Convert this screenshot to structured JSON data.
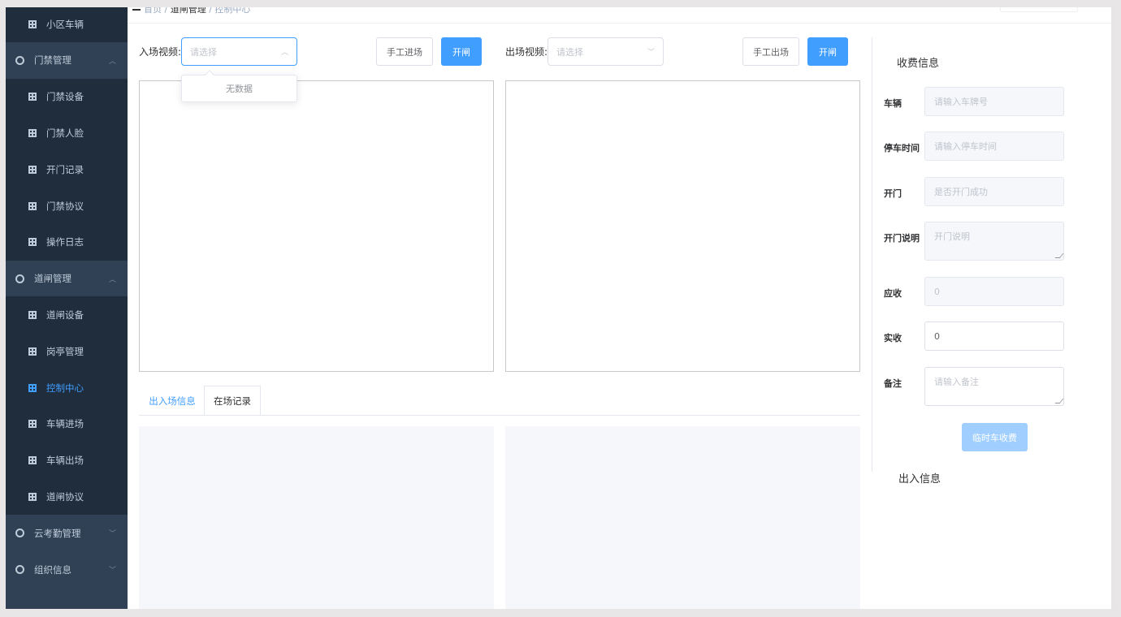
{
  "sidebar": {
    "items": [
      {
        "label": "小区车辆",
        "kind": "sub",
        "icon": "grid-icon"
      },
      {
        "label": "门禁管理",
        "kind": "group",
        "icon": "gear-icon",
        "chevron": "^"
      },
      {
        "label": "门禁设备",
        "kind": "sub",
        "icon": "grid-icon"
      },
      {
        "label": "门禁人脸",
        "kind": "sub",
        "icon": "grid-icon"
      },
      {
        "label": "开门记录",
        "kind": "sub",
        "icon": "grid-icon"
      },
      {
        "label": "门禁协议",
        "kind": "sub",
        "icon": "grid-icon"
      },
      {
        "label": "操作日志",
        "kind": "sub",
        "icon": "grid-icon"
      },
      {
        "label": "道闸管理",
        "kind": "group",
        "icon": "gear-icon",
        "chevron": "^"
      },
      {
        "label": "道闸设备",
        "kind": "sub",
        "icon": "grid-icon"
      },
      {
        "label": "岗亭管理",
        "kind": "sub",
        "icon": "grid-icon"
      },
      {
        "label": "控制中心",
        "kind": "sub",
        "icon": "grid-icon",
        "active": true
      },
      {
        "label": "车辆进场",
        "kind": "sub",
        "icon": "grid-icon"
      },
      {
        "label": "车辆出场",
        "kind": "sub",
        "icon": "grid-icon"
      },
      {
        "label": "道闸协议",
        "kind": "sub",
        "icon": "grid-icon"
      },
      {
        "label": "云考勤管理",
        "kind": "group",
        "icon": "gear-icon",
        "chevron": "v"
      },
      {
        "label": "组织信息",
        "kind": "group",
        "icon": "gear-icon",
        "chevron": "v"
      }
    ]
  },
  "breadcrumb": {
    "home": "首页",
    "level2": "道闸管理",
    "current": "控制中心"
  },
  "entry": {
    "label": "入场视频:",
    "select_placeholder": "请选择",
    "manual_button": "手工进场",
    "open_button": "开闸",
    "dropdown_empty": "无数据"
  },
  "exit": {
    "label": "出场视频:",
    "select_placeholder": "请选择",
    "manual_button": "手工出场",
    "open_button": "开闸"
  },
  "tabs": [
    {
      "label": "出入场信息",
      "active": true
    },
    {
      "label": "在场记录",
      "active": false
    }
  ],
  "fee": {
    "title": "收费信息",
    "fields": [
      {
        "label": "车辆",
        "placeholder": "请输入车牌号",
        "value": ""
      },
      {
        "label": "停车时间",
        "placeholder": "请输入停车时间",
        "value": ""
      },
      {
        "label": "开门",
        "placeholder": "是否开门成功",
        "value": ""
      },
      {
        "label": "开门说明",
        "placeholder": "开门说明",
        "value": ""
      },
      {
        "label": "应收",
        "placeholder": "",
        "value": "0"
      },
      {
        "label": "实收",
        "placeholder": "",
        "value": "0"
      },
      {
        "label": "备注",
        "placeholder": "请输入备注",
        "value": ""
      }
    ],
    "submit_button": "临时车收费",
    "io_title": "出入信息"
  },
  "colors": {
    "sidebar_bg": "#304156",
    "submenu_bg": "#1f2d3d",
    "primary": "#409eff",
    "primary_disabled": "#a0cfff"
  }
}
